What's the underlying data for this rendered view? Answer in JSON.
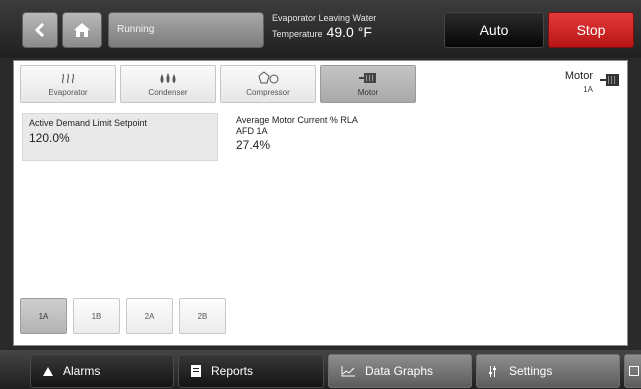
{
  "topbar": {
    "status": "Running",
    "lwt_label_line1": "Evaporator Leaving Water",
    "lwt_label_line2": "Temperature",
    "lwt_value": "49.0",
    "lwt_unit": "°F",
    "auto_label": "Auto",
    "stop_label": "Stop"
  },
  "tabs": [
    {
      "label": "Evaporator",
      "icon": "evaporator-icon"
    },
    {
      "label": "Condenser",
      "icon": "condenser-icon"
    },
    {
      "label": "Compressor",
      "icon": "compressor-icon"
    },
    {
      "label": "Motor",
      "icon": "motor-icon",
      "active": true
    }
  ],
  "motor_header": {
    "title": "Motor",
    "unit": "1A"
  },
  "demand": {
    "label": "Active Demand Limit Setpoint",
    "value": "120.0%"
  },
  "current": {
    "label_line1": "Average Motor Current % RLA",
    "label_line2": "AFD 1A",
    "value": "27.4%"
  },
  "units": [
    "1A",
    "1B",
    "2A",
    "2B"
  ],
  "units_selected": "1A",
  "nav": {
    "alarms": "Alarms",
    "reports": "Reports",
    "graphs": "Data Graphs",
    "settings": "Settings"
  },
  "colors": {
    "stop": "#d42626",
    "active_tab": "#b5b5b5"
  }
}
